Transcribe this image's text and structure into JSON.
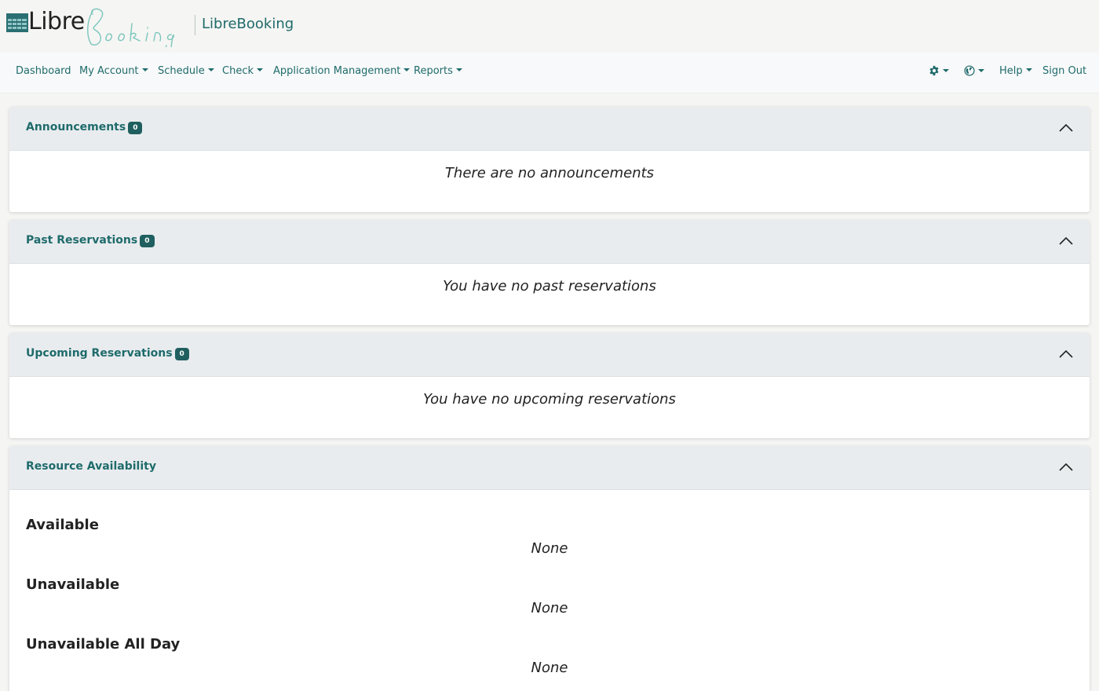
{
  "brand": {
    "logo_libre": "Libre",
    "logo_booking": "Booking",
    "name": "LibreBooking"
  },
  "nav": {
    "dashboard": "Dashboard",
    "my_account": "My Account",
    "schedule": "Schedule",
    "check": "Check",
    "app_management": "Application Management",
    "reports": "Reports",
    "help": "Help",
    "sign_out": "Sign Out",
    "settings_icon": "gear-icon",
    "language_icon": "globe-icon"
  },
  "cards": {
    "announcements": {
      "title": "Announcements",
      "count": "0",
      "message": "There are no announcements"
    },
    "past": {
      "title": "Past Reservations",
      "count": "0",
      "message": "You have no past reservations"
    },
    "upcoming": {
      "title": "Upcoming Reservations",
      "count": "0",
      "message": "You have no upcoming reservations"
    },
    "availability": {
      "title": "Resource Availability",
      "available_label": "Available",
      "available_value": "None",
      "unavailable_label": "Unavailable",
      "unavailable_value": "None",
      "unavailable_all_day_label": "Unavailable All Day",
      "unavailable_all_day_value": "None"
    }
  },
  "colors": {
    "accent": "#1f6b6b",
    "badge": "#1f5f5f",
    "header_bg": "#e9ecef",
    "page_bg": "#f5f5f3"
  }
}
